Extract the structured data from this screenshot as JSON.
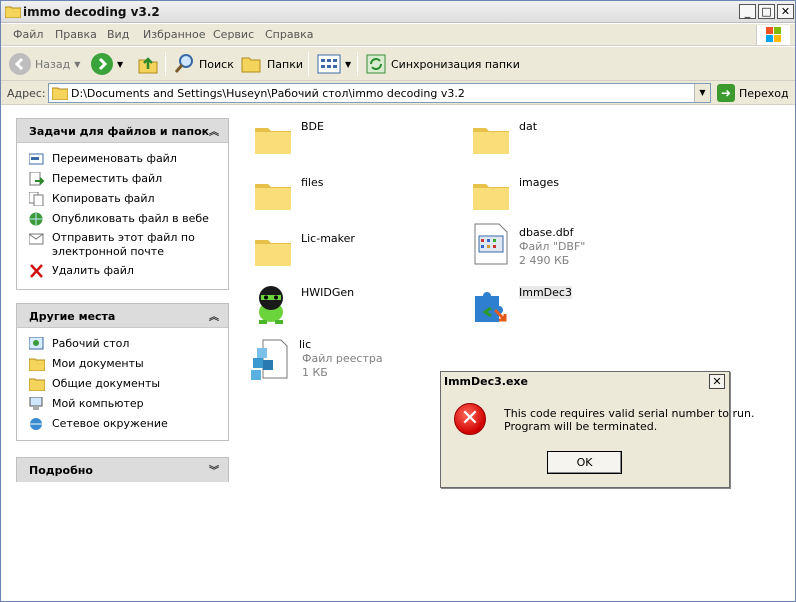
{
  "window": {
    "title": "immo decoding v3.2",
    "controls": [
      "_",
      "□",
      "✕"
    ]
  },
  "menu": [
    "Файл",
    "Правка",
    "Вид",
    "Избранное",
    "Сервис",
    "Справка"
  ],
  "toolbar": {
    "back": "Назад",
    "search": "Поиск",
    "folders": "Папки",
    "sync": "Синхронизация папки"
  },
  "address": {
    "label": "Адрес:",
    "value": "D:\\Documents and Settings\\Huseyn\\Рабочий стол\\immo decoding v3.2",
    "go": "Переход"
  },
  "tasks_panel": {
    "title": "Задачи для файлов и папок",
    "items": [
      {
        "label": "Переименовать файл",
        "icon": "rename-icon"
      },
      {
        "label": "Переместить файл",
        "icon": "move-icon"
      },
      {
        "label": "Копировать файл",
        "icon": "copy-icon"
      },
      {
        "label": "Опубликовать файл в вебе",
        "icon": "globe-icon"
      },
      {
        "label": "Отправить этот файл по электронной почте",
        "icon": "email-icon"
      },
      {
        "label": "Удалить файл",
        "icon": "delete-icon"
      }
    ]
  },
  "places_panel": {
    "title": "Другие места",
    "items": [
      {
        "label": "Рабочий стол",
        "icon": "desktop-icon"
      },
      {
        "label": "Мои документы",
        "icon": "folder-icon"
      },
      {
        "label": "Общие документы",
        "icon": "folder-icon"
      },
      {
        "label": "Мой компьютер",
        "icon": "computer-icon"
      },
      {
        "label": "Сетевое окружение",
        "icon": "network-icon"
      }
    ]
  },
  "details_panel": {
    "title": "Подробно"
  },
  "files": [
    {
      "name": "BDE",
      "type": "folder"
    },
    {
      "name": "dat",
      "type": "folder"
    },
    {
      "name": "files",
      "type": "folder"
    },
    {
      "name": "images",
      "type": "folder"
    },
    {
      "name": "Lic-maker",
      "type": "folder"
    },
    {
      "name": "dbase.dbf",
      "type": "dbf",
      "kind": "Файл \"DBF\"",
      "size": "2 490 КБ"
    },
    {
      "name": "HWIDGen",
      "type": "app"
    },
    {
      "name": "ImmDec3",
      "type": "app"
    },
    {
      "name": "lic",
      "type": "reg",
      "kind": "Файл реестра",
      "size": "1 КБ"
    }
  ],
  "dialog": {
    "title": "ImmDec3.exe",
    "close": "✕",
    "line1": "This code requires valid serial number to run.",
    "line2": "Program will be terminated.",
    "ok": "OK",
    "icon": "error-icon"
  },
  "colors": {
    "panel_head": "#dcdcdc",
    "dialog_bg": "#ece9d8",
    "folder": "#f6d96b",
    "error": "#d00000"
  }
}
